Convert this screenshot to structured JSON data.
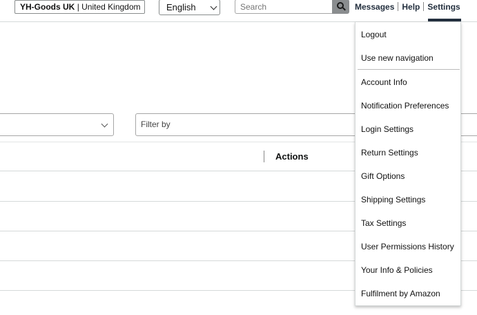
{
  "topbar": {
    "store_name": "YH-Goods UK",
    "store_region": "United Kingdom",
    "language": "English",
    "search_placeholder": "Search",
    "nav": {
      "messages": "Messages",
      "help": "Help",
      "settings": "Settings"
    }
  },
  "filters": {
    "filter_placeholder": "Filter by"
  },
  "table": {
    "actions_header": "Actions"
  },
  "settings_menu": {
    "top_items": [
      {
        "label": "Logout"
      },
      {
        "label": "Use new navigation"
      }
    ],
    "items": [
      {
        "label": "Account Info"
      },
      {
        "label": "Notification Preferences"
      },
      {
        "label": "Login Settings"
      },
      {
        "label": "Return Settings"
      },
      {
        "label": "Gift Options"
      },
      {
        "label": "Shipping Settings"
      },
      {
        "label": "Tax Settings"
      },
      {
        "label": "User Permissions History"
      },
      {
        "label": "Your Info & Policies"
      },
      {
        "label": "Fulfilment by Amazon"
      }
    ]
  },
  "colors": {
    "nav_text": "#232f3e",
    "search_button": "#8a8d8f",
    "border": "#d5d9d9"
  }
}
